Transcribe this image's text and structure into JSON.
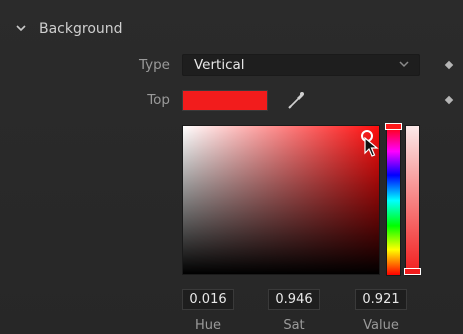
{
  "section": {
    "title": "Background",
    "expanded": true
  },
  "type_row": {
    "label": "Type",
    "value": "Vertical"
  },
  "top_row": {
    "label": "Top",
    "color": "#f21c1c"
  },
  "color_picker": {
    "hue": {
      "value": "0.016",
      "label": "Hue"
    },
    "sat": {
      "value": "0.946",
      "label": "Sat"
    },
    "val": {
      "value": "0.921",
      "label": "Value"
    },
    "hue_color": "#ff0d0d"
  },
  "colors": {
    "background": "#2a2a2a",
    "field": "#1e1e1e",
    "text": "#e8e8e8",
    "label": "#9a9a9a"
  }
}
